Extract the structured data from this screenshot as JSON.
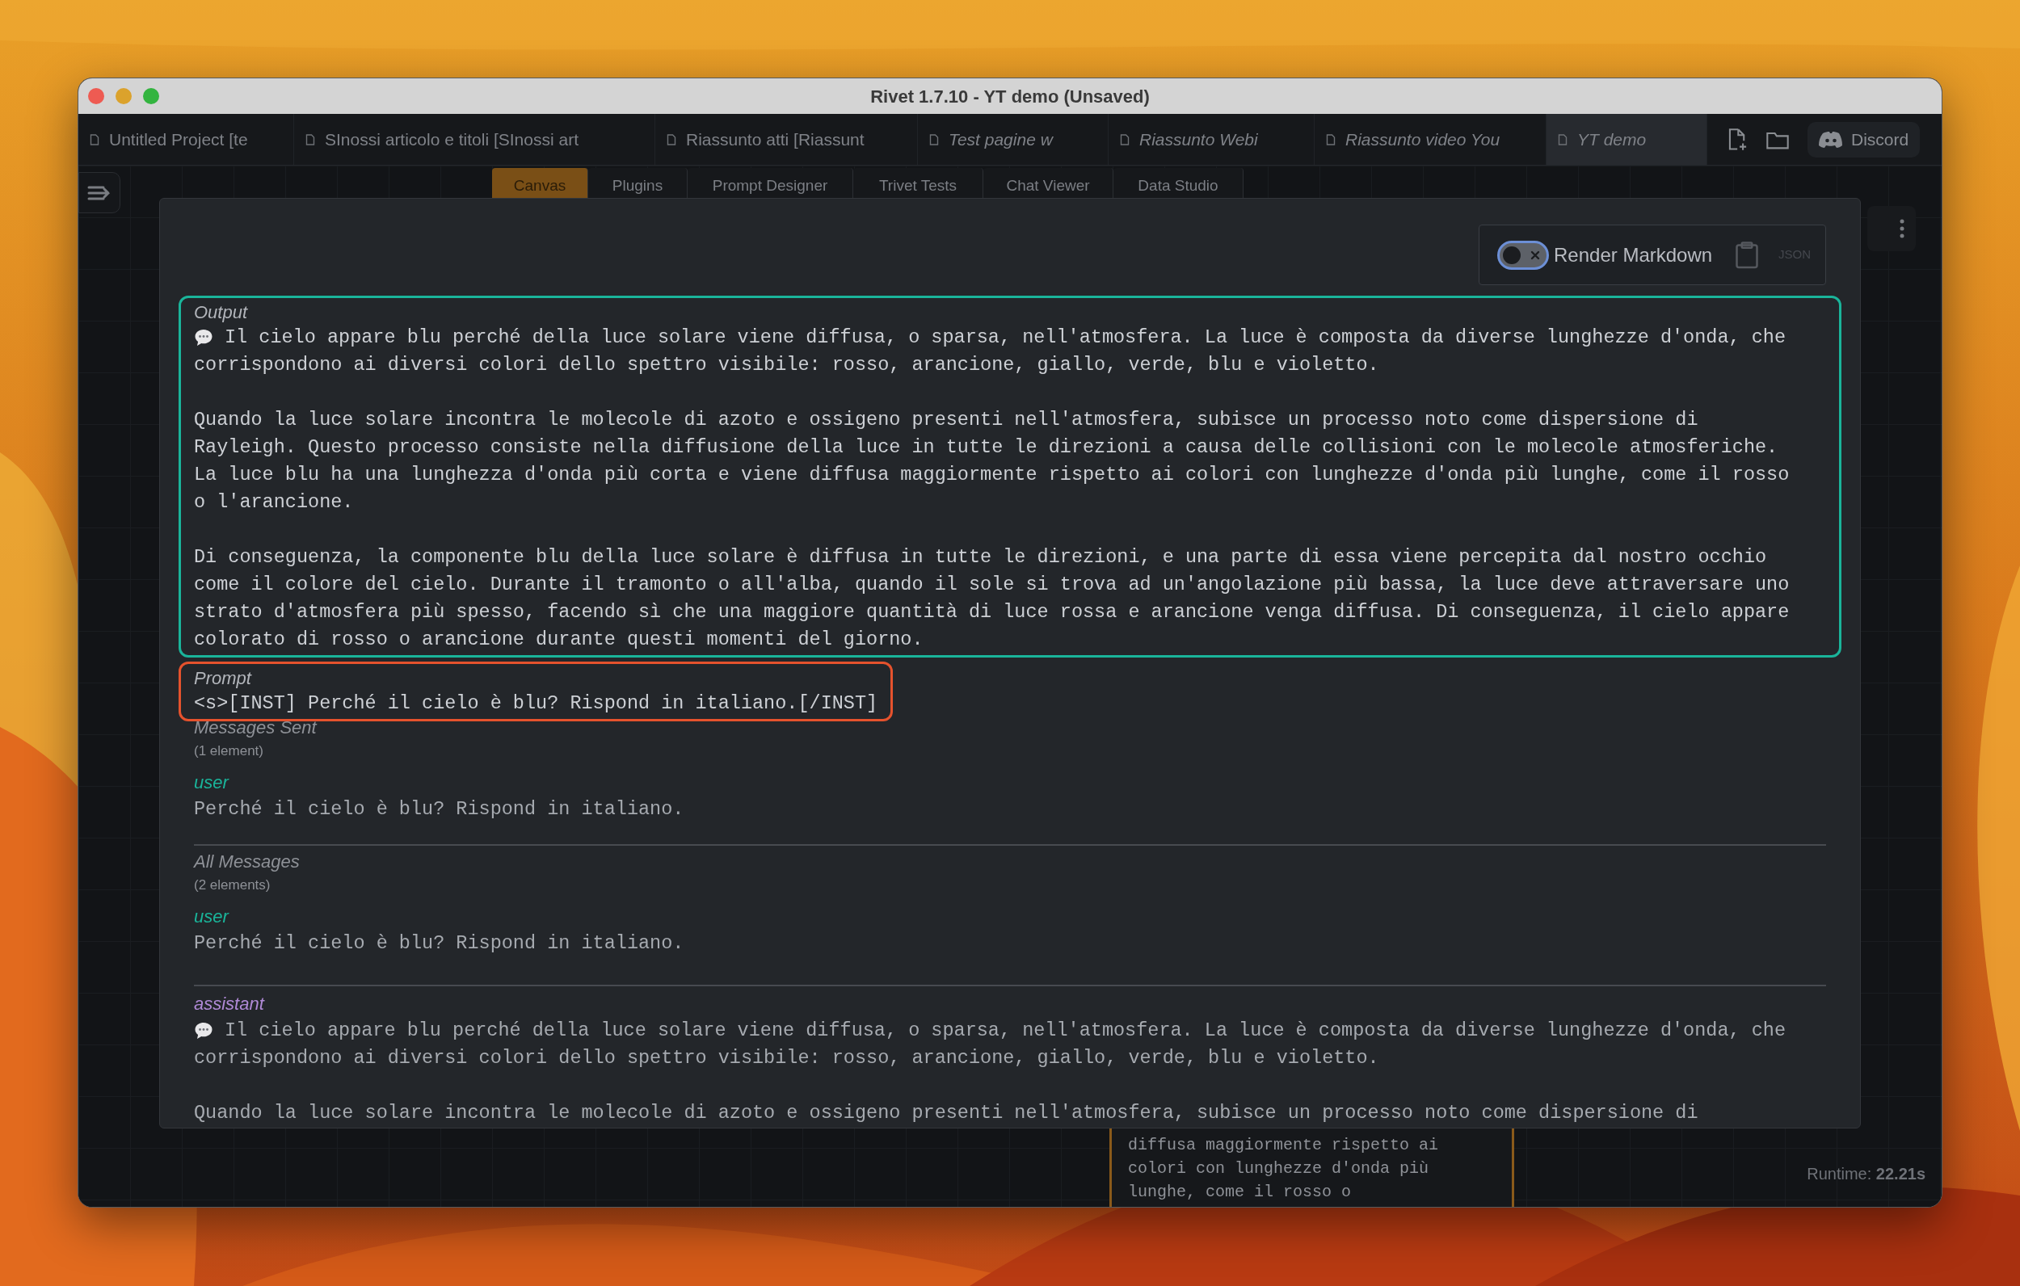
{
  "window": {
    "title": "Rivet 1.7.10 - YT demo (Unsaved)"
  },
  "project_tabs": [
    {
      "label": "Untitled Project [te",
      "selected": false,
      "modified": false
    },
    {
      "label": "SInossi articolo e titoli [SInossi art",
      "selected": false,
      "modified": false
    },
    {
      "label": "Riassunto atti [Riassunt",
      "selected": false,
      "modified": false
    },
    {
      "label": "Test pagine w",
      "selected": false,
      "modified": true
    },
    {
      "label": "Riassunto Webi",
      "selected": false,
      "modified": true
    },
    {
      "label": "Riassunto video You",
      "selected": false,
      "modified": true
    },
    {
      "label": "YT demo",
      "selected": true,
      "modified": true
    }
  ],
  "toolbar": {
    "discord_label": "Discord"
  },
  "view_tabs": [
    {
      "label": "Canvas",
      "selected": true
    },
    {
      "label": "Plugins",
      "selected": false
    },
    {
      "label": "Prompt Designer",
      "selected": false
    },
    {
      "label": "Trivet Tests",
      "selected": false
    },
    {
      "label": "Chat Viewer",
      "selected": false
    },
    {
      "label": "Data Studio",
      "selected": false
    }
  ],
  "output_panel": {
    "render_markdown": {
      "label": "Render Markdown",
      "on": false
    },
    "json_label": "JSON",
    "sections": [
      {
        "kind": "text",
        "label": "Output",
        "color": "#1ab49a",
        "bubble": true,
        "paragraphs": [
          [
            "Il cielo appare blu perché della luce solare viene diffusa, o sparsa, nell'atmosfera. La luce è composta da diverse lunghezze d'onda, che",
            "corrispondono ai diversi colori dello spettro visibile: rosso, arancione, giallo, verde, blu e violetto."
          ],
          [
            "Quando la luce solare incontra le molecole di azoto e ossigeno presenti nell'atmosfera, subisce un processo noto come dispersione di",
            "Rayleigh. Questo processo consiste nella diffusione della luce in tutte le direzioni a causa delle collisioni con le molecole atmosferiche.",
            "La luce blu ha una lunghezza d'onda più corta e viene diffusa maggiormente rispetto ai colori con lunghezze d'onda più lunghe, come il rosso",
            "o l'arancione."
          ],
          [
            "Di conseguenza, la componente blu della luce solare è diffusa in tutte le direzioni, e una parte di essa viene percepita dal nostro occhio",
            "come il colore del cielo. Durante il tramonto o all'alba, quando il sole si trova ad un'angolazione più bassa, la luce deve attraversare uno",
            "strato d'atmosfera più spesso, facendo sì che una maggiore quantità di luce rossa e arancione venga diffusa. Di conseguenza, il cielo appare",
            "colorato di rosso o arancione durante questi momenti del giorno."
          ]
        ]
      },
      {
        "kind": "text",
        "label": "Prompt",
        "color": "#e5522d",
        "bubble": false,
        "paragraphs": [
          [
            "<s>[INST] Perché il cielo è blu? Rispond in italiano.[/INST]"
          ]
        ]
      },
      {
        "kind": "messages",
        "label": "Messages Sent",
        "count": "(1 element)",
        "messages": [
          {
            "role": "user",
            "color": "#1ab49a",
            "bubble": false,
            "paragraphs": [
              [
                "Perché il cielo è blu? Rispond in italiano."
              ]
            ]
          }
        ]
      },
      {
        "kind": "messages",
        "label": "All Messages",
        "count": "(2 elements)",
        "messages": [
          {
            "role": "user",
            "color": "#1ab49a",
            "bubble": false,
            "paragraphs": [
              [
                "Perché il cielo è blu? Rispond in italiano."
              ]
            ]
          },
          {
            "role": "assistant",
            "color": "#b08ad6",
            "bubble": true,
            "paragraphs": [
              [
                "Il cielo appare blu perché della luce solare viene diffusa, o sparsa, nell'atmosfera. La luce è composta da diverse lunghezze d'onda, che",
                "corrispondono ai diversi colori dello spettro visibile: rosso, arancione, giallo, verde, blu e violetto."
              ],
              [
                "Quando la luce solare incontra le molecole di azoto e ossigeno presenti nell'atmosfera, subisce un processo noto come dispersione di"
              ]
            ]
          }
        ]
      }
    ]
  },
  "background_node": {
    "lines": [
      "diffusa maggiormente rispetto ai",
      "colori con lunghezze d'onda più",
      "lunghe, come il rosso o"
    ]
  },
  "runtime": "Runtime: **22.21s**"
}
